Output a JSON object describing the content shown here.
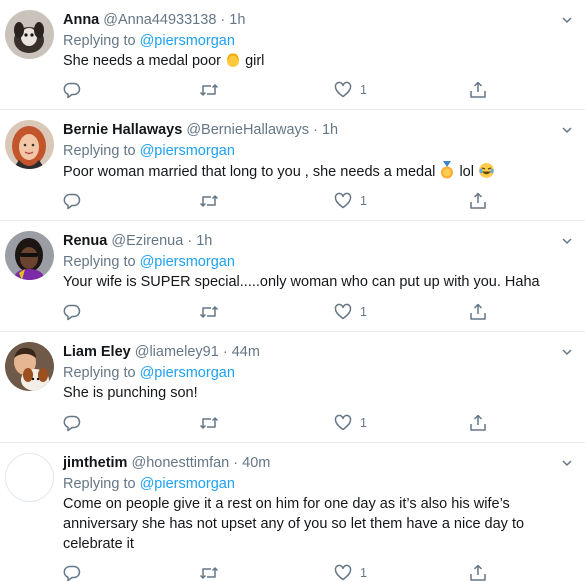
{
  "replying_label": "Replying to",
  "mention": "@piersmorgan",
  "tweets": [
    {
      "name": "Anna",
      "handle": "@Anna44933138",
      "dot": "·",
      "time": "1h",
      "text_a": "She needs a medal poor",
      "text_b": "girl",
      "emoji_a": "person-emoji",
      "like_count": "1"
    },
    {
      "name": "Bernie Hallaways",
      "handle": "@BernieHallaways",
      "dot": "·",
      "time": "1h",
      "text_a": "Poor woman married that long to you , she needs a medal",
      "text_b": "lol",
      "emoji_a": "medal-emoji",
      "emoji_b": "laughing-emoji",
      "like_count": "1"
    },
    {
      "name": "Renua",
      "handle": "@Ezirenua",
      "dot": "·",
      "time": "1h",
      "text": "Your wife is SUPER special.....only woman who can put up with you. Haha",
      "like_count": "1"
    },
    {
      "name": "Liam Eley",
      "handle": "@liameley91",
      "dot": "·",
      "time": "44m",
      "text": "She is punching son!",
      "like_count": "1"
    },
    {
      "name": "jimthetim",
      "handle": "@honesttimfan",
      "dot": "·",
      "time": "40m",
      "text": "Come on people give it a rest on him for one day as it’s also his wife’s anniversary she has not upset any of you so let them have a nice day to celebrate it",
      "like_count": "1"
    }
  ],
  "icons": {
    "reply": "reply-icon",
    "retweet": "retweet-icon",
    "like": "like-icon",
    "share": "share-icon",
    "caret": "chevron-down-icon"
  },
  "colors": {
    "mention": "#1da1f2",
    "secondary_text": "#657786",
    "divider": "#e6ecf0"
  }
}
